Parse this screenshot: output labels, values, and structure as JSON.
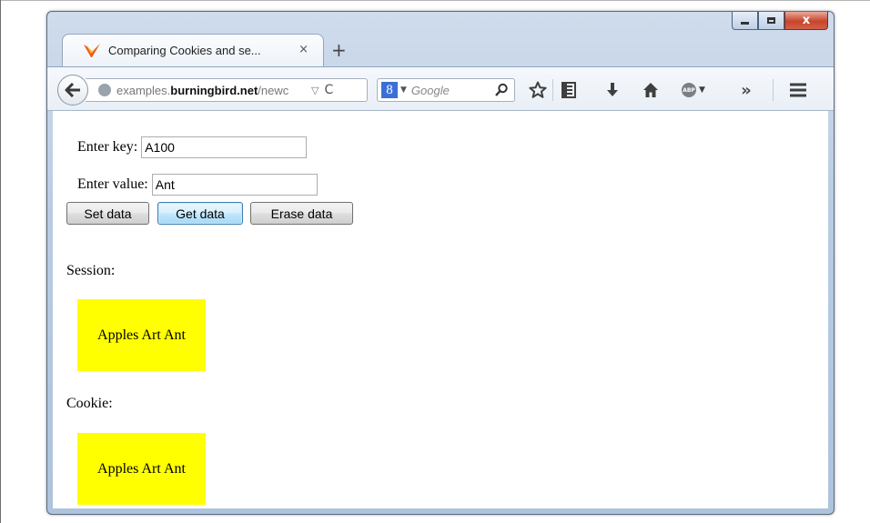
{
  "browser": {
    "tab_title": "Comparing Cookies and se...",
    "tab_close": "×",
    "new_tab": "+",
    "url_prefix": "examples.",
    "url_host": "burningbird.net",
    "url_path": "/newc",
    "url_dropdown": "▽",
    "reload": "C",
    "search_engine": "8",
    "search_placeholder": "Google",
    "window_close": "x"
  },
  "form": {
    "key_label": "Enter key:",
    "key_value": "A100",
    "value_label": "Enter value:",
    "value_value": "Ant",
    "buttons": {
      "set": "Set data",
      "get": "Get data",
      "erase": "Erase data"
    }
  },
  "session": {
    "label": "Session:",
    "content": "Apples Art Ant",
    "box_color": "#ffff00"
  },
  "cookie": {
    "label": "Cookie:",
    "content": "Apples Art Ant",
    "box_color": "#ffff00"
  },
  "icons": [
    "firefox-icon",
    "back-arrow-icon",
    "globe-icon",
    "reload-icon",
    "google-icon",
    "search-icon",
    "star-icon",
    "reading-list-icon",
    "download-icon",
    "home-icon",
    "adblock-icon",
    "overflow-icon",
    "menu-icon"
  ]
}
